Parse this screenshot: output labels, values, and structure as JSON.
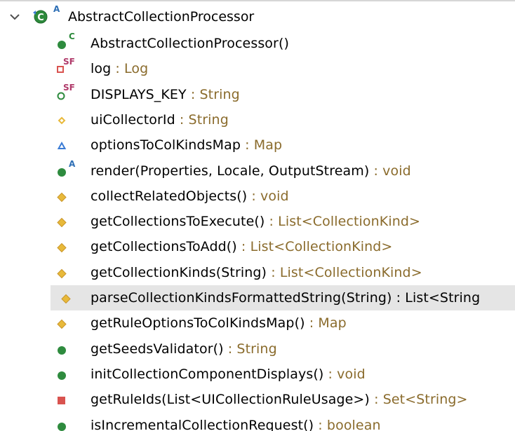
{
  "outline": {
    "class_name": "AbstractCollectionProcessor",
    "class_decorator": "A",
    "members": [
      {
        "name": "AbstractCollectionProcessor()",
        "type": "",
        "icon": "public-constructor-icon",
        "decorator": "C"
      },
      {
        "name": "log",
        "type": " : Log",
        "icon": "private-static-final-field-icon",
        "decorator": "SF"
      },
      {
        "name": "DISPLAYS_KEY",
        "type": " : String",
        "icon": "public-static-final-field-icon",
        "decorator": "SF"
      },
      {
        "name": "uiCollectorId",
        "type": " : String",
        "icon": "package-field-icon",
        "decorator": ""
      },
      {
        "name": "optionsToColKindsMap",
        "type": " : Map",
        "icon": "protected-field-icon",
        "decorator": ""
      },
      {
        "name": "render(Properties, Locale, OutputStream)",
        "type": " : void",
        "icon": "public-abstract-method-icon",
        "decorator": "A"
      },
      {
        "name": "collectRelatedObjects()",
        "type": " : void",
        "icon": "package-method-icon",
        "decorator": ""
      },
      {
        "name": "getCollectionsToExecute()",
        "type": " : List<CollectionKind>",
        "icon": "package-method-icon",
        "decorator": ""
      },
      {
        "name": "getCollectionsToAdd()",
        "type": " : List<CollectionKind>",
        "icon": "package-method-icon",
        "decorator": ""
      },
      {
        "name": "getCollectionKinds(String)",
        "type": " : List<CollectionKind>",
        "icon": "package-method-icon",
        "decorator": ""
      },
      {
        "name": "parseCollectionKindsFormattedString(String)",
        "type": " : List<String",
        "icon": "package-method-icon",
        "decorator": "",
        "selected": true
      },
      {
        "name": "getRuleOptionsToColKindsMap()",
        "type": " : Map",
        "icon": "package-method-icon",
        "decorator": ""
      },
      {
        "name": "getSeedsValidator()",
        "type": " : String",
        "icon": "public-method-icon",
        "decorator": ""
      },
      {
        "name": "initCollectionComponentDisplays()",
        "type": " : void",
        "icon": "public-method-icon",
        "decorator": ""
      },
      {
        "name": "getRuleIds(List<UICollectionRuleUsage>)",
        "type": " : Set<String>",
        "icon": "private-method-icon",
        "decorator": ""
      },
      {
        "name": "isIncrementalCollectionRequest()",
        "type": " : boolean",
        "icon": "public-method-icon",
        "decorator": ""
      }
    ]
  },
  "colors": {
    "type_text": "#8a6b2c",
    "public_green": "#2e8b3e",
    "private_red": "#d9534f",
    "package_yellow": "#e8b93a",
    "protected_blue": "#3a7bd5",
    "selection": "#e5e5e5"
  }
}
